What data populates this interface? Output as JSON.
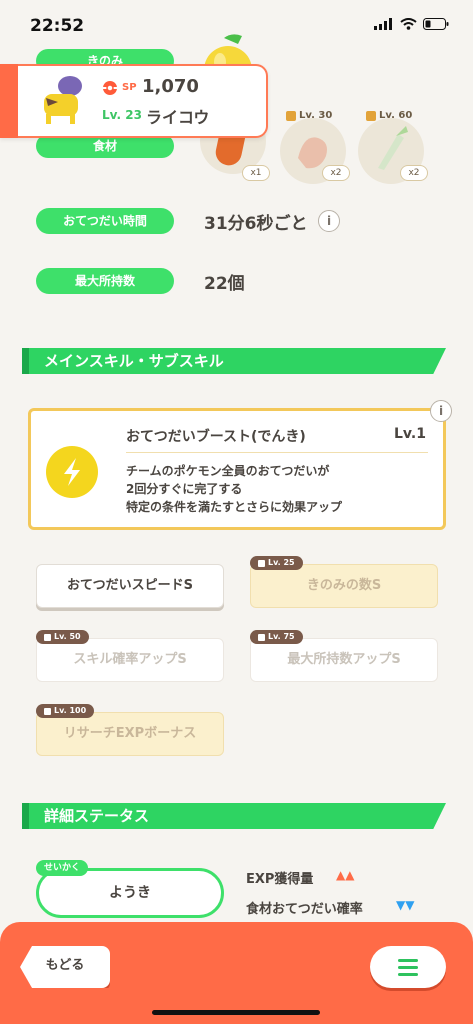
{
  "status_bar": {
    "time": "22:52"
  },
  "header": {
    "sp_label": "SP",
    "sp_value": "1,070",
    "level": "Lv. 23",
    "name": "ライコウ"
  },
  "top_labels": {
    "berry": "きのみ",
    "ingredient": "食材"
  },
  "ingredients": [
    {
      "qty": "x1",
      "lock": ""
    },
    {
      "qty": "x2",
      "lock": "Lv. 30"
    },
    {
      "qty": "x2",
      "lock": "Lv. 60"
    }
  ],
  "stats": [
    {
      "label": "おてつだい時間",
      "value": "31分6秒ごと"
    },
    {
      "label": "最大所持数",
      "value": "22個"
    }
  ],
  "main_skill_section": {
    "title": "メインスキル・サブスキル"
  },
  "main_skill": {
    "name": "おてつだいブースト(でんき)",
    "level": "Lv.1",
    "desc1": "チームのポケモン全員のおてつだいが",
    "desc2": "2回分すぐに完了する",
    "desc3": "特定の条件を満たすとさらに効果アップ"
  },
  "sub_skills": [
    {
      "label": "おてつだいスピードS",
      "lock": ""
    },
    {
      "label": "きのみの数S",
      "lock": "Lv. 25"
    },
    {
      "label": "スキル確率アップS",
      "lock": "Lv. 50"
    },
    {
      "label": "最大所持数アップS",
      "lock": "Lv. 75"
    },
    {
      "label": "リサーチEXPボーナス",
      "lock": "Lv. 100"
    }
  ],
  "detail_section": {
    "title": "詳細ステータス"
  },
  "nature": {
    "tag": "せいかく",
    "value": "ようき"
  },
  "nature_effects": [
    {
      "label": "EXP獲得量",
      "arrows": "▲▲",
      "color": "#ff6b47"
    },
    {
      "label": "食材おてつだい確率",
      "arrows": "▼▼",
      "color": "#2fa0f0"
    }
  ],
  "bottom": {
    "back_label": "もどる"
  }
}
